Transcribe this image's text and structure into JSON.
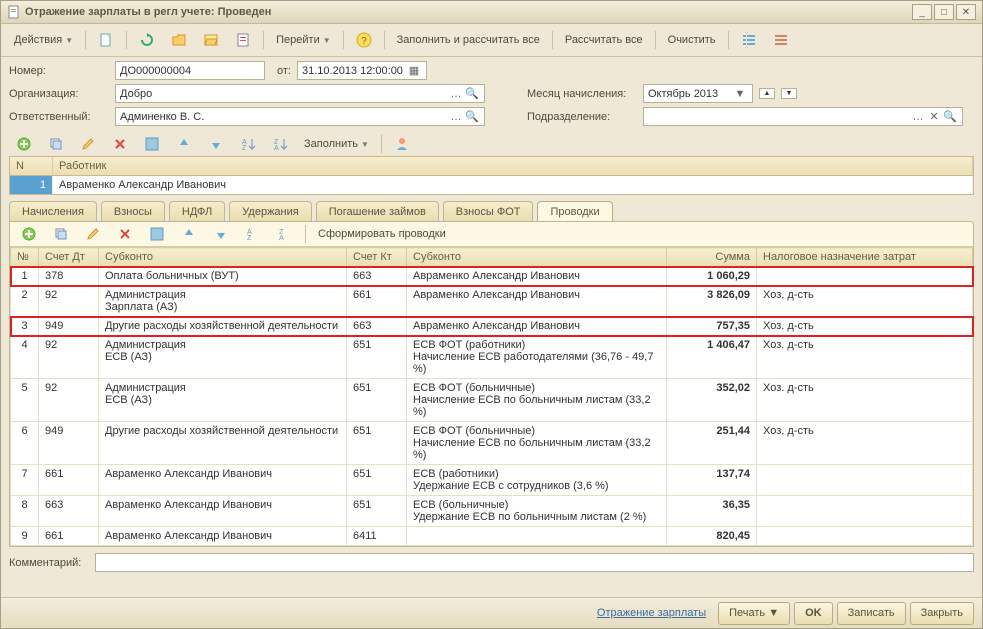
{
  "window": {
    "title": "Отражение зарплаты в регл учете: Проведен"
  },
  "toolbar": {
    "actions": "Действия",
    "goto": "Перейти",
    "fill_calc_all": "Заполнить и рассчитать все",
    "calc_all": "Рассчитать все",
    "clear": "Очистить"
  },
  "form": {
    "number_label": "Номер:",
    "number_value": "ДО000000004",
    "date_label": "от:",
    "date_value": "31.10.2013 12:00:00",
    "org_label": "Организация:",
    "org_value": "Добро",
    "resp_label": "Ответственный:",
    "resp_value": "Админенко В. С.",
    "month_label": "Месяц начисления:",
    "month_value": "Октябрь 2013",
    "div_label": "Подразделение:",
    "div_value": ""
  },
  "subtoolbar": {
    "fill": "Заполнить"
  },
  "top_grid": {
    "col_n": "N",
    "col_worker": "Работник",
    "row1_n": "1",
    "row1_worker": "Авраменко Александр Иванович"
  },
  "tabs": {
    "t1": "Начисления",
    "t2": "Взносы",
    "t3": "НДФЛ",
    "t4": "Удержания",
    "t5": "Погашение займов",
    "t6": "Взносы ФОТ",
    "t7": "Проводки"
  },
  "panel_toolbar": {
    "make_entries": "Сформировать проводки"
  },
  "grid": {
    "headers": {
      "n": "№",
      "dt": "Счет Дт",
      "sub1": "Субконто",
      "kt": "Счет Кт",
      "sub2": "Субконто",
      "sum": "Сумма",
      "tax": "Налоговое назначение затрат"
    },
    "rows": [
      {
        "n": "1",
        "dt": "378",
        "s1a": "Оплата больничных (ВУТ)",
        "s1b": "",
        "kt": "663",
        "s2a": "Авраменко Александр Иванович",
        "s2b": "",
        "sum": "1 060,29",
        "tax": ""
      },
      {
        "n": "2",
        "dt": "92",
        "s1a": "Администрация",
        "s1b": "Зарплата (АЗ)",
        "kt": "661",
        "s2a": "Авраменко Александр Иванович",
        "s2b": "",
        "sum": "3 826,09",
        "tax": "Хоз. д-сть"
      },
      {
        "n": "3",
        "dt": "949",
        "s1a": "Другие расходы хозяйственной деятельности",
        "s1b": "",
        "kt": "663",
        "s2a": "Авраменко Александр Иванович",
        "s2b": "",
        "sum": "757,35",
        "tax": "Хоз. д-сть"
      },
      {
        "n": "4",
        "dt": "92",
        "s1a": "Администрация",
        "s1b": "ЕСВ (АЗ)",
        "kt": "651",
        "s2a": "ЕСВ ФОТ (работники)",
        "s2b": "Начисление ЕСВ работодателями (36,76 - 49,7 %)",
        "sum": "1 406,47",
        "tax": "Хоз. д-сть"
      },
      {
        "n": "5",
        "dt": "92",
        "s1a": "Администрация",
        "s1b": "ЕСВ (АЗ)",
        "kt": "651",
        "s2a": "ЕСВ ФОТ (больничные)",
        "s2b": "Начисление ЕСВ по больничным листам (33,2 %)",
        "sum": "352,02",
        "tax": "Хоз. д-сть"
      },
      {
        "n": "6",
        "dt": "949",
        "s1a": "Другие расходы хозяйственной деятельности",
        "s1b": "",
        "kt": "651",
        "s2a": "ЕСВ ФОТ (больничные)",
        "s2b": "Начисление ЕСВ по больничным листам (33,2 %)",
        "sum": "251,44",
        "tax": "Хоз. д-сть"
      },
      {
        "n": "7",
        "dt": "661",
        "s1a": "Авраменко Александр Иванович",
        "s1b": "",
        "kt": "651",
        "s2a": "ЕСВ (работники)",
        "s2b": "Удержание ЕСВ с сотрудников (3,6 %)",
        "sum": "137,74",
        "tax": ""
      },
      {
        "n": "8",
        "dt": "663",
        "s1a": "Авраменко Александр Иванович",
        "s1b": "",
        "kt": "651",
        "s2a": "ЕСВ (больничные)",
        "s2b": "Удержание ЕСВ по больничным листам (2 %)",
        "sum": "36,35",
        "tax": ""
      },
      {
        "n": "9",
        "dt": "661",
        "s1a": "Авраменко Александр Иванович",
        "s1b": "",
        "kt": "6411",
        "s2a": "",
        "s2b": "",
        "sum": "820,45",
        "tax": ""
      }
    ]
  },
  "comment_label": "Комментарий:",
  "comment_value": "",
  "footer": {
    "link": "Отражение зарплаты",
    "print": "Печать",
    "ok": "OK",
    "save": "Записать",
    "close": "Закрыть"
  }
}
